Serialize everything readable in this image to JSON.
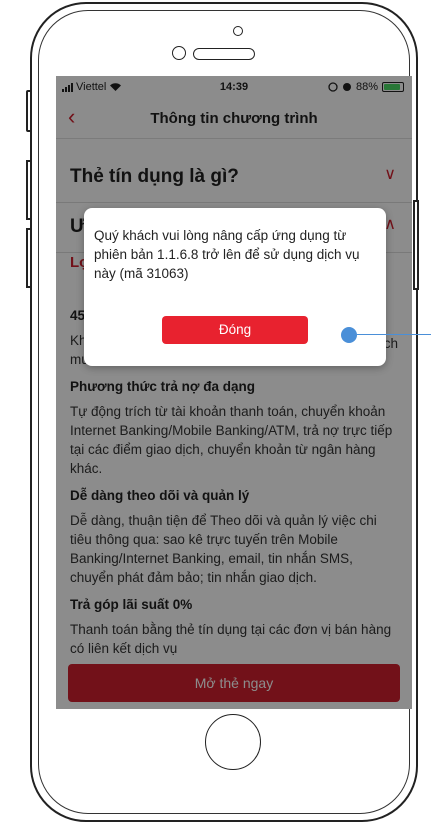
{
  "status_bar": {
    "carrier": "Viettel",
    "time": "14:39",
    "battery": "88%",
    "battery_level": 0.88
  },
  "nav": {
    "title": "Thông tin chương trình"
  },
  "sections": [
    {
      "title": "Thẻ tín dụng là gì?"
    },
    {
      "title": "Ư"
    }
  ],
  "benefits": {
    "heading": "Lợ",
    "item1_prefix": "45",
    "item1_text": "Kh\nmư",
    "item1_tail": "ch",
    "payment_title": "Phương thức trả nợ đa dạng",
    "payment_text": "Tự động trích từ tài khoản thanh toán, chuyển khoản Internet Banking/Mobile Banking/ATM, trả nợ trực tiếp tại các điểm giao dịch, chuyển khoản từ ngân hàng khác.",
    "track_title": "Dễ dàng theo dõi và quản lý",
    "track_text": "Dễ dàng, thuận tiện để Theo dõi và quản lý việc chi tiêu thông qua: sao kê trực tuyến trên Mobile Banking/Internet Banking, email, tin nhắn SMS, chuyển phát đảm bảo; tin nhắn giao dịch.",
    "installment_title": "Trả góp lãi suất 0%",
    "installment_text": "Thanh toán bằng thẻ tín dụng tại các đơn vị bán hàng có liên kết dịch vụ"
  },
  "cta": {
    "label": "Mở thẻ ngay"
  },
  "dialog": {
    "message": "Quý khách vui lòng nâng cấp ứng dụng từ phiên bản 1.1.6.8 trở lên để sử dụng dịch vụ này (mã 31063)",
    "button": "Đóng"
  },
  "icons": {
    "back": "chevron-left-icon",
    "expand": "chevron-down-icon",
    "collapse": "chevron-up-icon",
    "wifi": "wifi-icon",
    "alarm": "alarm-icon",
    "battery": "battery-icon"
  },
  "colors": {
    "brand_red": "#d0202e",
    "annotation_blue": "#4a8fd8"
  }
}
